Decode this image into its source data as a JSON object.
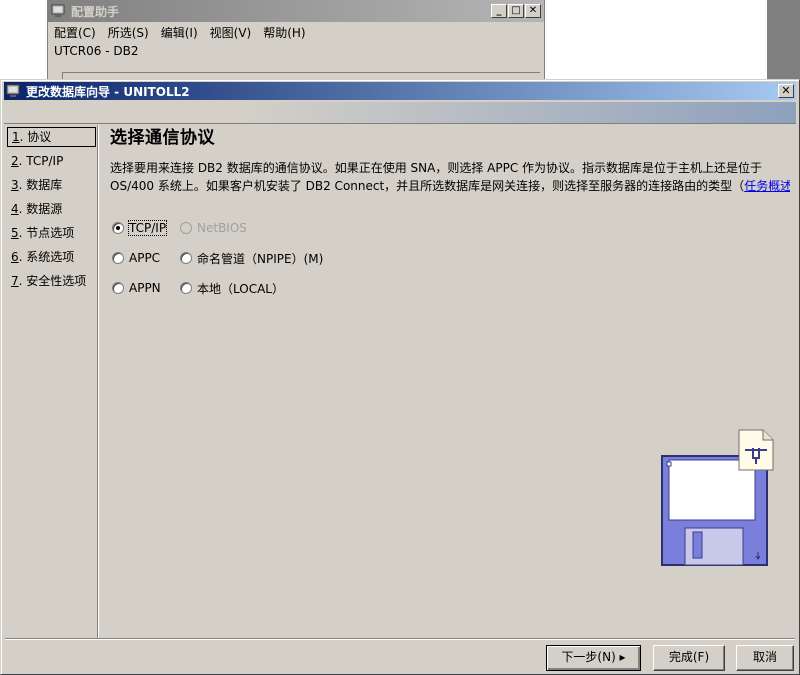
{
  "background_window": {
    "title": "配置助手",
    "menu": [
      "配置(C)",
      "所选(S)",
      "编辑(I)",
      "视图(V)",
      "帮助(H)"
    ],
    "subtitle": "UTCR06 - DB2"
  },
  "dialog": {
    "title": "更改数据库向导 - UNITOLL2",
    "nav": [
      {
        "num": "1",
        "label": ". 协议"
      },
      {
        "num": "2",
        "label": ". TCP/IP"
      },
      {
        "num": "3",
        "label": ". 数据库"
      },
      {
        "num": "4",
        "label": ". 数据源"
      },
      {
        "num": "5",
        "label": ". 节点选项"
      },
      {
        "num": "6",
        "label": ". 系统选项"
      },
      {
        "num": "7",
        "label": ". 安全性选项"
      }
    ],
    "heading": "选择通信协议",
    "desc_line1": "选择要用来连接 DB2 数据库的通信协议。如果正在使用 SNA，则选择 APPC 作为协议。指示数据库是位于主机上还是位于",
    "desc_line2": "OS/400 系统上。如果客户机安装了 DB2 Connect，并且所选数据库是网关连接，则选择至服务器的连接路由的类型（",
    "desc_link": "任务概述",
    "desc_tail": "）",
    "protocols": {
      "tcpip": "TCP/IP",
      "netbios": "NetBIOS",
      "appc": "APPC",
      "npipe": "命名管道（NPIPE）(M)",
      "appn": "APPN",
      "local": "本地（LOCAL）"
    },
    "selected": "TCP/IP",
    "buttons": {
      "next": "下一步(N) ▸",
      "finish": "完成(F)",
      "cancel": "取消"
    },
    "colors": {
      "title_active": "#0a246a",
      "title_inactive": "#808080",
      "face": "#d4d0c8",
      "disk": "#7b7fdc",
      "link": "#0000ee"
    }
  }
}
